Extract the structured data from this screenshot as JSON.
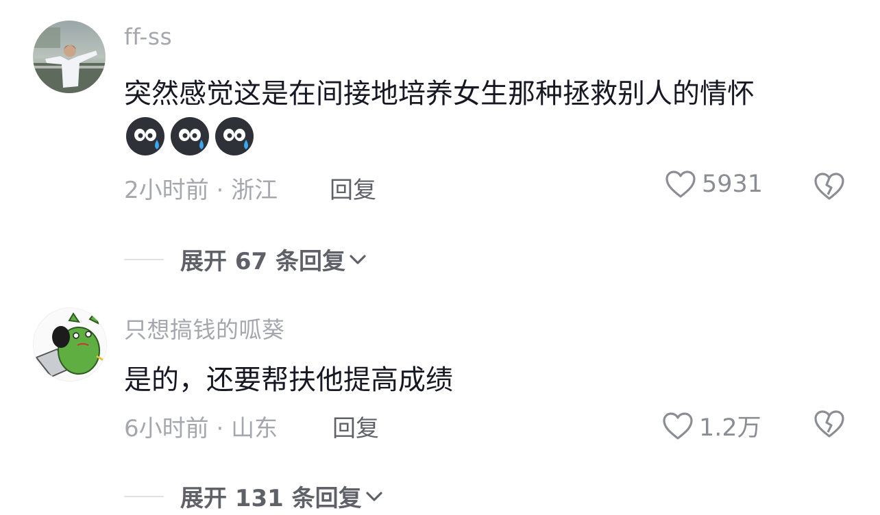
{
  "comments": [
    {
      "username": "ff-ss",
      "text": "突然感觉这是在间接地培养女生那种拯救别人的情怀",
      "emojis": [
        "sweat-face-emoji",
        "sweat-face-emoji",
        "sweat-face-emoji"
      ],
      "time": "2小时前",
      "separator": "·",
      "location": "浙江",
      "reply_label": "回复",
      "likes": "5931",
      "expand_label": "展开 67 条回复"
    },
    {
      "username": "只想搞钱的呱葵",
      "text": "是的，还要帮扶他提高成绩",
      "time": "6小时前",
      "separator": "·",
      "location": "山东",
      "reply_label": "回复",
      "likes": "1.2万",
      "expand_label": "展开 131 条回复"
    }
  ],
  "icons": {
    "like": "heart-outline-icon",
    "dislike": "broken-heart-icon",
    "expand": "chevron-down-icon"
  },
  "colors": {
    "text": "#161823",
    "muted": "#a4a7ae",
    "secondary": "#5f6169"
  }
}
